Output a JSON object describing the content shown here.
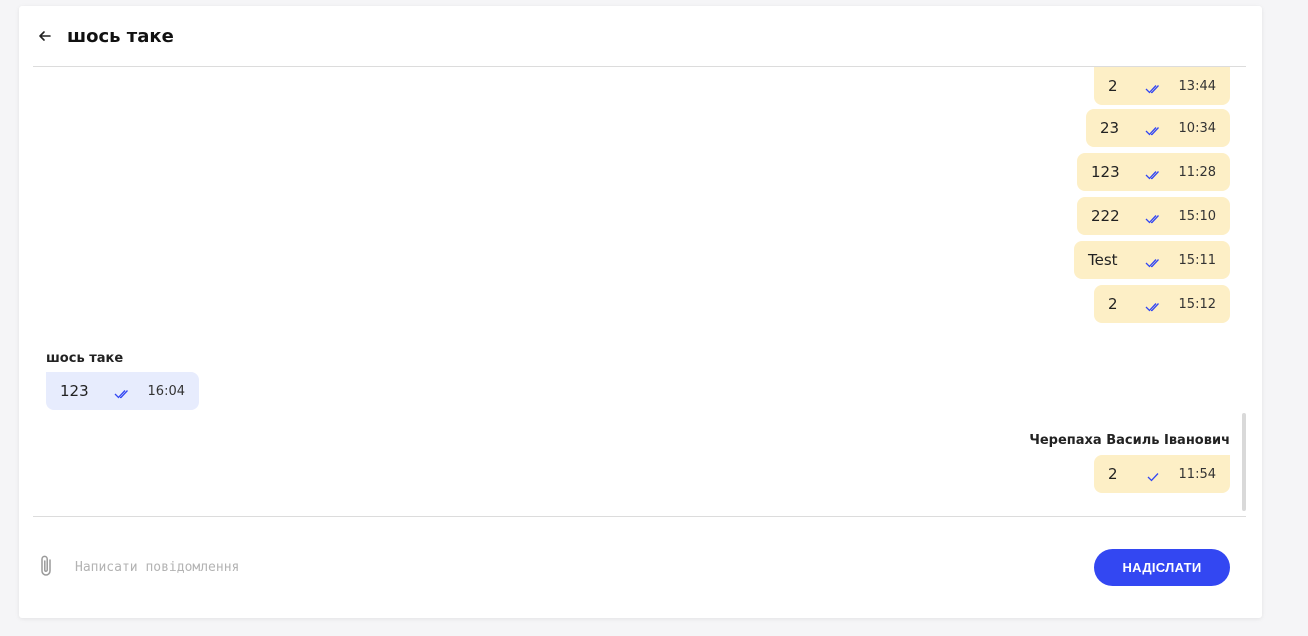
{
  "chat": {
    "title": "шось таке"
  },
  "messages_outgoing_top": [
    {
      "text": "2",
      "time": "13:44",
      "status": "read"
    },
    {
      "text": "23",
      "time": "10:34",
      "status": "read"
    },
    {
      "text": "123",
      "time": "11:28",
      "status": "read"
    },
    {
      "text": "222",
      "time": "15:10",
      "status": "read"
    },
    {
      "text": "Test",
      "time": "15:11",
      "status": "read"
    },
    {
      "text": "2",
      "time": "15:12",
      "status": "read"
    }
  ],
  "incoming_group": {
    "sender": "шось таке",
    "message": {
      "text": "123",
      "time": "16:04",
      "status": "read"
    }
  },
  "outgoing_group": {
    "sender": "Черепаха Василь Іванович",
    "message": {
      "text": "2",
      "time": "11:54",
      "status": "sent"
    }
  },
  "composer": {
    "placeholder": "Написати повідомлення",
    "send_label": "НАДІСЛАТИ"
  },
  "icons": {
    "back": "arrow-left-icon",
    "attach": "paperclip-icon",
    "read": "double-check-icon",
    "sent": "single-check-icon"
  },
  "colors": {
    "accent": "#3347f2",
    "outgoing_bubble": "#fdefc6",
    "incoming_bubble": "#e7ecfd",
    "check": "#3347f2"
  }
}
